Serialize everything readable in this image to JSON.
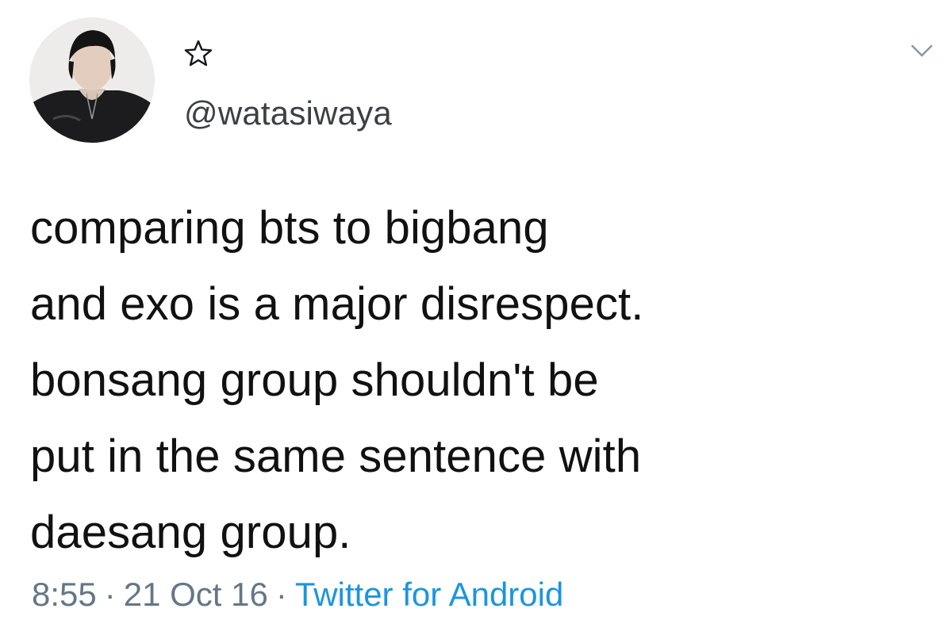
{
  "user": {
    "handle": "@watasiwaya",
    "display_name_icon": "star-outline-icon"
  },
  "tweet": {
    "lines": [
      "comparing bts to bigbang",
      "and exo is a major disrespect.",
      "bonsang group shouldn't be",
      "put in the same sentence with",
      "daesang group."
    ]
  },
  "meta": {
    "time": "8:55",
    "date": "21 Oct 16",
    "separator": "·",
    "source": "Twitter for Android"
  },
  "colors": {
    "text": "#111111",
    "meta": "#657786",
    "link": "#1b95e0"
  },
  "icons": {
    "menu": "chevron-down-icon",
    "favorite": "star-outline-icon"
  }
}
